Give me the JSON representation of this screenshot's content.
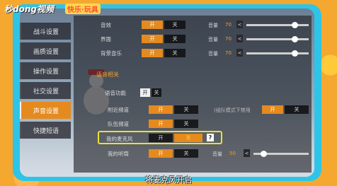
{
  "watermark": {
    "site": "秒dong视频",
    "badge": "快乐·玩具"
  },
  "sidebar": {
    "items": [
      {
        "label": "战斗设置"
      },
      {
        "label": "画质设置"
      },
      {
        "label": "操作设置"
      },
      {
        "label": "社交设置"
      },
      {
        "label": "声音设置"
      },
      {
        "label": "快捷短语"
      }
    ],
    "active_index": 4
  },
  "audio": {
    "rows": [
      {
        "label": "音效",
        "on": "开",
        "off": "关",
        "volume_label": "音量",
        "volume": "70"
      },
      {
        "label": "界面",
        "on": "开",
        "off": "关",
        "volume_label": "音量",
        "volume": "70"
      },
      {
        "label": "背景音乐",
        "on": "开",
        "off": "关",
        "volume_label": "音量",
        "volume": "70"
      }
    ],
    "decrement": "<",
    "increment": ">"
  },
  "voice": {
    "section_title": "语音相关",
    "function_label": "语音功能",
    "function_on": "开",
    "function_off": "关",
    "nearby_label": "附近频道",
    "nearby_on": "开",
    "nearby_off": "关",
    "mode_note": "(组队模式下禁用",
    "mode_on": "开",
    "mode_off": "关",
    "team_label": "队伍频道",
    "team_on": "开",
    "team_off": "关",
    "mic_label": "我的麦克风",
    "mic_on": "开",
    "mic_off": "关",
    "help_glyph": "?",
    "hearing_label": "我的听筒",
    "hearing_on": "开",
    "hearing_off": "关",
    "hearing_volume_label": "音量",
    "hearing_volume": "50"
  },
  "caption": "将麦克风开启",
  "colors": {
    "accent": "#e58a1f",
    "frame": "#2ec4e8",
    "highlight": "#e8e03a"
  }
}
